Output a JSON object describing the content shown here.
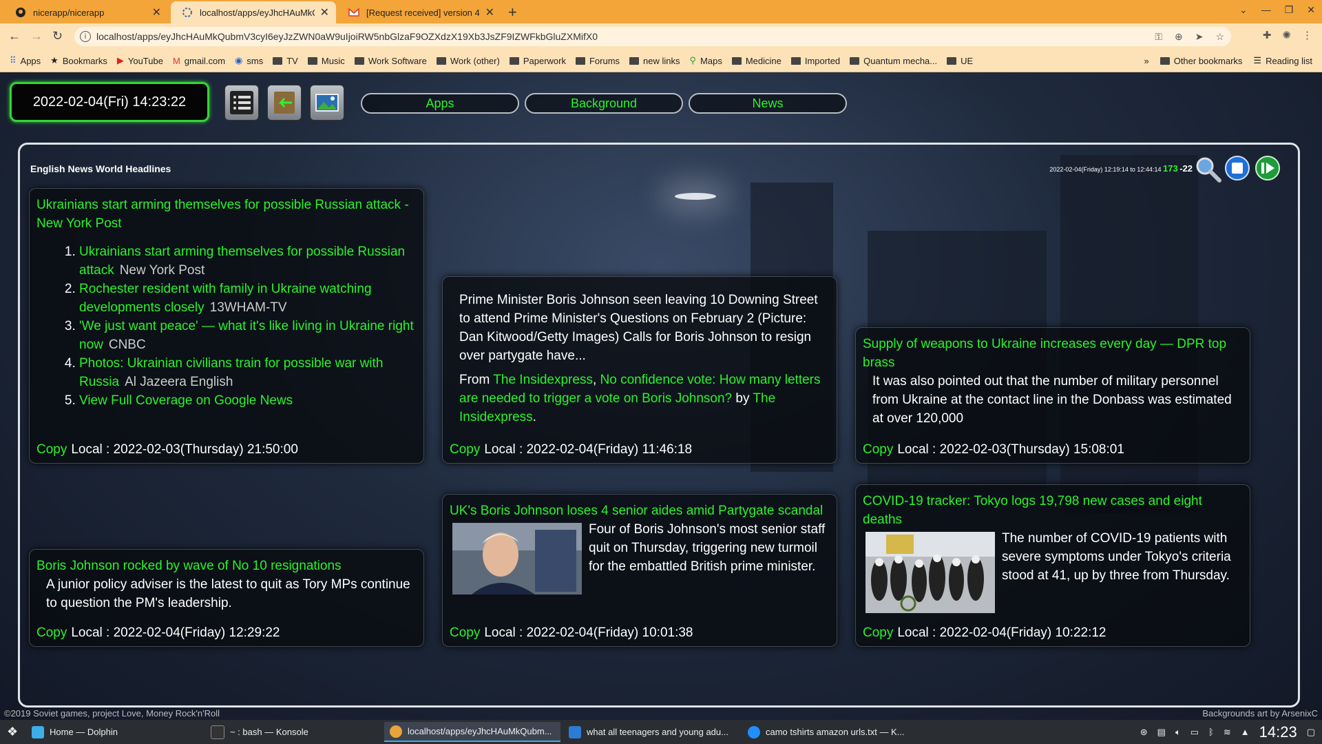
{
  "browser": {
    "tabs": [
      {
        "title": "nicerapp/nicerapp",
        "icon": "github-icon"
      },
      {
        "title": "localhost/apps/eyJhcHAuMkQubm",
        "icon": "nicerapp-icon",
        "active": true
      },
      {
        "title": "[Request received] version 4.",
        "icon": "gmail-icon"
      }
    ],
    "url": "localhost/apps/eyJhcHAuMkQubmV3cyI6eyJzZWN0aW9uIjoiRW5nbGlzaF9OZXdzX19Xb3JsZF9IZWFkbGluZXMifX0",
    "bookmarks": [
      "Apps",
      "Bookmarks",
      "YouTube",
      "gmail.com",
      "sms",
      "TV",
      "Music",
      "Work Software",
      "Work (other)",
      "Paperwork",
      "Forums",
      "new links",
      "Maps",
      "Medicine",
      "Imported",
      "Quantum mecha...",
      "UE"
    ],
    "other_bookmarks": "Other bookmarks",
    "reading_list": "Reading list",
    "overflow": "»"
  },
  "app": {
    "datetime": "2022-02-04(Fri) 14:23:22",
    "menu": [
      "Apps",
      "Background",
      "News"
    ],
    "panel_title": "English News World Headlines",
    "stats_range": "2022-02-04(Friday) 12:19:14 to 12:44:14",
    "stats_count": "173",
    "stats_delta": "-22"
  },
  "cards": {
    "c1": {
      "headline": "Ukrainians start arming themselves for possible Russian attack - New York Post",
      "items": [
        {
          "title": "Ukrainians start arming themselves for possible Russian attack",
          "source": "New York Post"
        },
        {
          "title": "Rochester resident with family in Ukraine watching developments closely",
          "source": "13WHAM-TV"
        },
        {
          "title": "'We just want peace' — what it's like living in Ukraine right now",
          "source": "CNBC"
        },
        {
          "title": "Photos: Ukrainian civilians train for possible war with Russia",
          "source": "Al Jazeera English"
        },
        {
          "title": "View Full Coverage on Google News",
          "source": ""
        }
      ],
      "copy": "Copy",
      "time": "Local : 2022-02-03(Thursday) 21:50:00"
    },
    "c2": {
      "desc": "Prime Minister Boris Johnson seen leaving 10 Downing Street to attend Prime Minister's Questions on February 2 (Picture: Dan Kitwood/Getty Images) Calls for Boris Johnson to resign over partygate have...",
      "from_label": "From",
      "from_source": "The Insidexpress",
      "link_title": "No confidence vote: How many letters are needed to trigger a vote on Boris Johnson?",
      "by_label": "by",
      "by_source": "The Insidexpress",
      "copy": "Copy",
      "time": "Local : 2022-02-04(Friday) 11:46:18"
    },
    "c3": {
      "headline": "Supply of weapons to Ukraine increases every day — DPR top brass",
      "desc": "It was also pointed out that the number of military personnel from Ukraine at the contact line in the Donbass was estimated at over 120,000",
      "copy": "Copy",
      "time": "Local : 2022-02-03(Thursday) 15:08:01"
    },
    "c4": {
      "headline": "Boris Johnson rocked by wave of No 10 resignations",
      "desc": "A junior policy adviser is the latest to quit as Tory MPs continue to question the PM's leadership.",
      "copy": "Copy",
      "time": "Local : 2022-02-04(Friday) 12:29:22"
    },
    "c5": {
      "headline": "UK's Boris Johnson loses 4 senior aides amid Partygate scandal",
      "desc": "Four of Boris Johnson's most senior staff quit on Thursday, triggering new turmoil for the embattled British prime minister.",
      "copy": "Copy",
      "time": "Local : 2022-02-04(Friday) 10:01:38"
    },
    "c6": {
      "headline": "COVID-19 tracker: Tokyo logs 19,798 new cases and eight deaths",
      "desc": "The number of COVID-19 patients with severe symptoms under Tokyo's criteria stood at 41, up by three from Thursday.",
      "copy": "Copy",
      "time": "Local : 2022-02-04(Friday) 10:22:12"
    }
  },
  "footer": {
    "left": "©2019 Soviet games, project Love, Money Rock'n'Roll",
    "right": "Backgrounds art by ArsenixC"
  },
  "taskbar": {
    "tasks": [
      "Home — Dolphin",
      "~ : bash — Konsole",
      "localhost/apps/eyJhcHAuMkQubm...",
      "what all teenagers and young adu...",
      "camo tshirts amazon urls.txt — K..."
    ],
    "clock": "14:23"
  },
  "colors": {
    "accent": "#2bf22b",
    "tabbar": "#f3a53a",
    "toolbar": "#fde2b8"
  }
}
